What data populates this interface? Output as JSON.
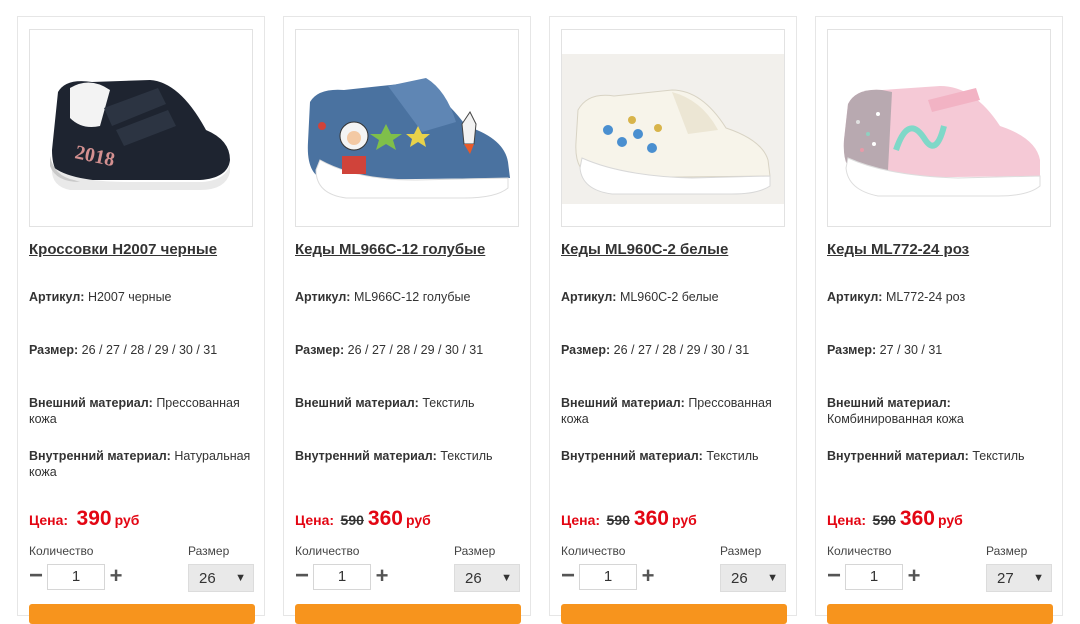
{
  "labels": {
    "article": "Артикул:",
    "size": "Размер:",
    "outer": "Внешний материал:",
    "inner": "Внутренний материал:",
    "price": "Цена:",
    "currency": "руб",
    "quantity": "Количество",
    "size_select": "Размер"
  },
  "colors": {
    "price": "#e30613",
    "buy_button": "#f7941d"
  },
  "products": [
    {
      "title": "Кроссовки H2007 черные",
      "article": "H2007 черные",
      "sizes": "26 / 27 / 28 / 29 / 30 / 31",
      "outer": "Прессованная кожа",
      "inner": "Натуральная кожа",
      "old_price": "",
      "price": "390",
      "qty": "1",
      "size": "26",
      "image_text": "2018"
    },
    {
      "title": "Кеды ML966C-12 голубые",
      "article": "ML966C-12 голубые",
      "sizes": "26 / 27 / 28 / 29 / 30 / 31",
      "outer": "Текстиль",
      "inner": "Текстиль",
      "old_price": "590",
      "price": "360",
      "qty": "1",
      "size": "26"
    },
    {
      "title": "Кеды ML960C-2 белые",
      "article": "ML960C-2 белые",
      "sizes": "26 / 27 / 28 / 29 / 30 / 31",
      "outer": "Прессованная кожа",
      "inner": "Текстиль",
      "old_price": "590",
      "price": "360",
      "qty": "1",
      "size": "26"
    },
    {
      "title": "Кеды ML772-24 роз",
      "article": "ML772-24 роз",
      "sizes": "27 / 30 / 31",
      "outer": "Комбинированная кожа",
      "inner": "Текстиль",
      "old_price": "590",
      "price": "360",
      "qty": "1",
      "size": "27"
    }
  ]
}
